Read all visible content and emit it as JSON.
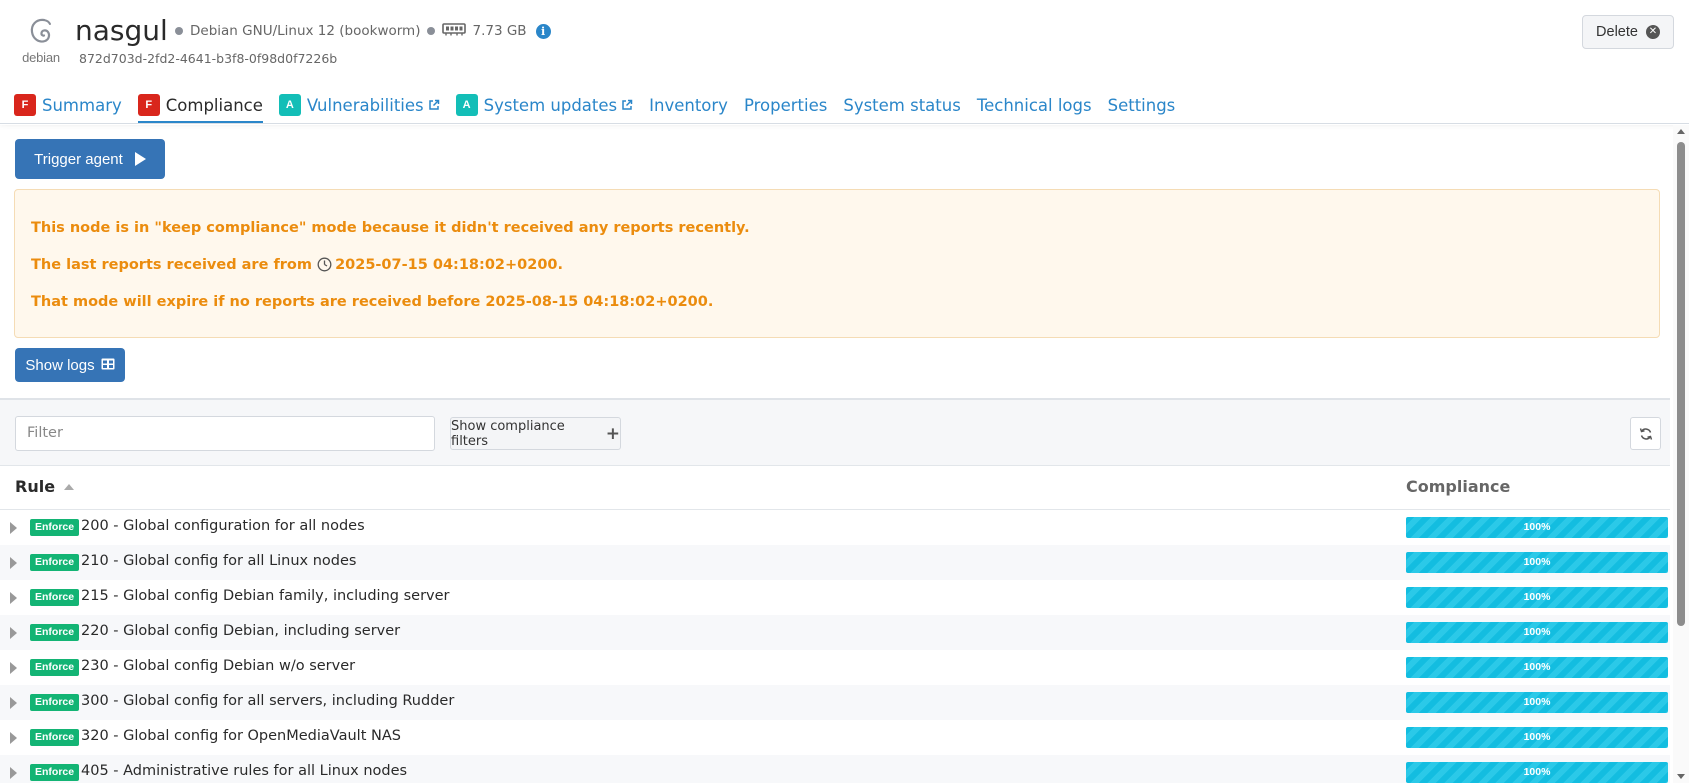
{
  "node": {
    "name": "nasgul",
    "os": "Debian GNU/Linux 12 (bookworm)",
    "ram": "7.73 GB",
    "uuid": "872d703d-2fd2-4641-b3f8-0f98d0f7226b",
    "logo_text": "debian",
    "logo_icon": "debian-swirl-icon"
  },
  "header": {
    "delete_label": "Delete"
  },
  "tabs": [
    {
      "label": "Summary",
      "grade": "F"
    },
    {
      "label": "Compliance",
      "grade": "F",
      "active": true
    },
    {
      "label": "Vulnerabilities",
      "grade": "A",
      "external": true
    },
    {
      "label": "System updates",
      "grade": "A",
      "external": true
    },
    {
      "label": "Inventory"
    },
    {
      "label": "Properties"
    },
    {
      "label": "System status"
    },
    {
      "label": "Technical logs"
    },
    {
      "label": "Settings"
    }
  ],
  "actions": {
    "trigger_agent": "Trigger agent",
    "show_logs": "Show logs"
  },
  "alert": {
    "line1": "This node is in \"keep compliance\" mode because it didn't received any reports recently.",
    "line2_prefix": "The last reports received are from",
    "line2_date": "2025-07-15 04:18:02+0200",
    "line2_suffix": ".",
    "line3": "That mode will expire if no reports are received before 2025-08-15 04:18:02+0200."
  },
  "filter": {
    "placeholder": "Filter",
    "compliance_filters_label": "Show compliance filters"
  },
  "table": {
    "columns": {
      "rule": "Rule",
      "compliance": "Compliance"
    },
    "rows": [
      {
        "mode": "Enforce",
        "name": "200 - Global configuration for all nodes",
        "compliance": "100%"
      },
      {
        "mode": "Enforce",
        "name": "210 - Global config for all Linux nodes",
        "compliance": "100%"
      },
      {
        "mode": "Enforce",
        "name": "215 - Global config Debian family, including server",
        "compliance": "100%"
      },
      {
        "mode": "Enforce",
        "name": "220 - Global config Debian, including server",
        "compliance": "100%"
      },
      {
        "mode": "Enforce",
        "name": "230 - Global config Debian w/o server",
        "compliance": "100%"
      },
      {
        "mode": "Enforce",
        "name": "300 - Global config for all servers, including Rudder",
        "compliance": "100%"
      },
      {
        "mode": "Enforce",
        "name": "320 - Global config for OpenMediaVault NAS",
        "compliance": "100%"
      },
      {
        "mode": "Enforce",
        "name": "405 - Administrative rules for all Linux nodes",
        "compliance": "100%"
      }
    ]
  },
  "colors": {
    "accent": "#2a86c9",
    "primary_button": "#3674b6",
    "grade_f": "#d9261c",
    "grade_a": "#13beb7",
    "enforce_badge": "#13b474",
    "compliance_bar": "#13bde0",
    "warning_text": "#eb8c0e",
    "warning_bg": "#fff8ed"
  }
}
